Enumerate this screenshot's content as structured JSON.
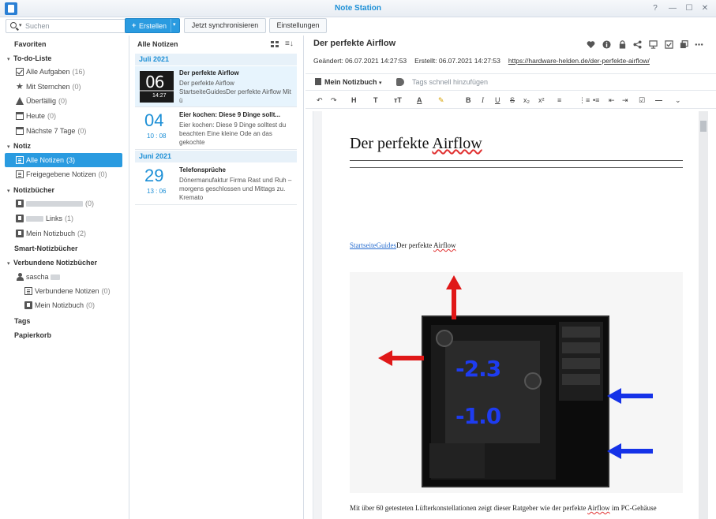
{
  "window": {
    "title": "Note Station",
    "controls": [
      "?",
      "—",
      "☐",
      "✕"
    ]
  },
  "toolbar": {
    "search_placeholder": "Suchen",
    "create_label": "Erstellen",
    "sync_label": "Jetzt synchronisieren",
    "settings_label": "Einstellungen"
  },
  "sidebar": {
    "favorites": "Favoriten",
    "todo_section": "To-do-Liste",
    "todo_items": [
      {
        "label": "Alle Aufgaben",
        "count": "(16)"
      },
      {
        "label": "Mit Sternchen",
        "count": "(0)"
      },
      {
        "label": "Überfällig",
        "count": "(0)"
      },
      {
        "label": "Heute",
        "count": "(0)"
      },
      {
        "label": "Nächste 7 Tage",
        "count": "(0)"
      }
    ],
    "notes_section": "Notiz",
    "notes_items": [
      {
        "label": "Alle Notizen",
        "count": "(3)"
      },
      {
        "label": "Freigegebene Notizen",
        "count": "(0)"
      }
    ],
    "notebooks_section": "Notizbücher",
    "notebook_items": [
      {
        "label": "",
        "count": "(0)"
      },
      {
        "label": "Links",
        "count": "(1)"
      },
      {
        "label": "Mein Notizbuch",
        "count": "(2)"
      }
    ],
    "smart_section": "Smart-Notizbücher",
    "connected_section": "Verbundene Notizbücher",
    "connected_user": "sascha",
    "connected_items": [
      {
        "label": "Verbundene Notizen",
        "count": "(0)"
      },
      {
        "label": "Mein Notizbuch",
        "count": "(0)"
      }
    ],
    "tags": "Tags",
    "trash": "Papierkorb"
  },
  "list": {
    "title": "Alle Notizen",
    "groups": [
      {
        "month": "Juli 2021",
        "notes": [
          {
            "title": "Der perfekte Airflow",
            "snippet": "Der perfekte Airflow          StartseiteGuidesDer perfekte Airflow   Mit ü",
            "thumb_big": "06",
            "thumb_small": "14:27"
          },
          {
            "title": "Eier kochen: Diese 9 Dinge sollt...",
            "snippet": "Eier kochen: Diese 9 Dinge solltest du beachten Eine kleine Ode an das gekochte",
            "day": "04",
            "time": "10 : 08"
          }
        ]
      },
      {
        "month": "Juni 2021",
        "notes": [
          {
            "title": "Telefonsprüche",
            "snippet": "Dönermanufaktur Firma Rast und Ruh – morgens geschlossen und Mittags zu. Kremato",
            "day": "29",
            "time": "13 : 06"
          }
        ]
      }
    ]
  },
  "note": {
    "title": "Der perfekte Airflow",
    "changed": "Geändert: 06.07.2021 14:27:53",
    "created": "Erstellt: 06.07.2021 14:27:53",
    "url": "https://hardware-helden.de/der-perfekte-airflow/",
    "notebook": "Mein Notizbuch",
    "tags_placeholder": "Tags schnell hinzufügen",
    "format_buttons": [
      "↶",
      "↷",
      "H",
      "T",
      "ᴛT",
      "A",
      "✎",
      "B",
      "I",
      "U",
      "S",
      "x₂",
      "x²",
      "≡",
      "⋮≡",
      "•≡",
      "⇤",
      "⇥",
      "☑",
      "—",
      "⌄"
    ],
    "body": {
      "heading_plain": "Der perfekte ",
      "heading_marked": "Airflow",
      "crumb_link": "StartseiteGuides",
      "crumb_plain": "Der perfekte ",
      "crumb_marked": "Airflow",
      "figure_values": [
        "-2.3",
        "-1.0"
      ],
      "text_start": "Mit über 60 getesteten Lüfterkonstellationen zeigt dieser Ratgeber wie der perfekte ",
      "text_marked": "Airflow",
      "text_end": " im PC-Gehäuse"
    }
  },
  "colors": {
    "accent": "#2a9be0",
    "title_blue": "#1c8fd6",
    "arrow_red": "#e01818",
    "arrow_blue": "#1532e8"
  }
}
